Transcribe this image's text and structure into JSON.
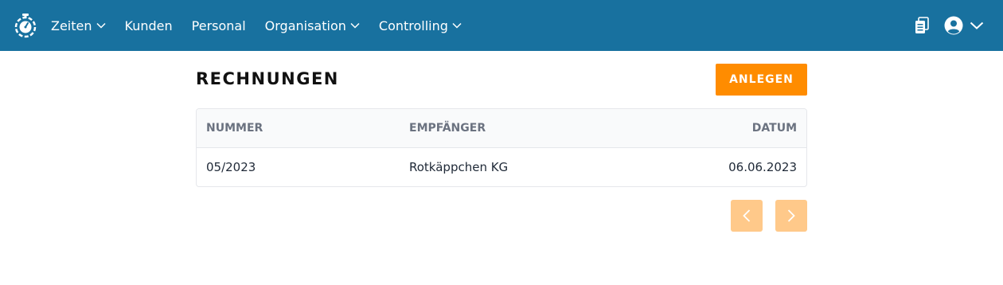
{
  "nav": {
    "items": [
      {
        "label": "Zeiten",
        "dropdown": true
      },
      {
        "label": "Kunden",
        "dropdown": false
      },
      {
        "label": "Personal",
        "dropdown": false
      },
      {
        "label": "Organisation",
        "dropdown": true
      },
      {
        "label": "Controlling",
        "dropdown": true
      }
    ],
    "icons": {
      "logo": "stopwatch-logo-icon",
      "documents": "clipboard-icon",
      "user": "user-circle-icon",
      "user_menu": "chevron-down-icon"
    }
  },
  "colors": {
    "navbar": "#18719f",
    "accent": "#ff8c00",
    "pagination": "#ffc98a"
  },
  "page": {
    "title": "RECHNUNGEN",
    "create_label": "ANLEGEN"
  },
  "table": {
    "headers": [
      "NUMMER",
      "EMPFÄNGER",
      "DATUM"
    ],
    "rows": [
      [
        "05/2023",
        "Rotkäppchen KG",
        "06.06.2023"
      ]
    ]
  },
  "pagination": {
    "prev_icon": "chevron-left-icon",
    "next_icon": "chevron-right-icon"
  }
}
